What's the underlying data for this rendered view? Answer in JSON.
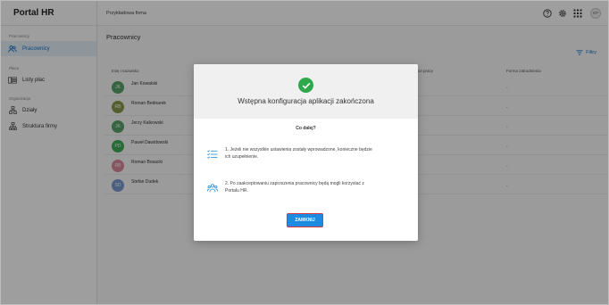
{
  "app": {
    "title": "Portal HR"
  },
  "sidebar": {
    "sections": [
      {
        "label": "Pracownicy",
        "items": [
          {
            "label": "Pracownicy",
            "icon": "people-icon",
            "active": true
          }
        ]
      },
      {
        "label": "Płace",
        "items": [
          {
            "label": "Listy płac",
            "icon": "payroll-icon",
            "active": false
          }
        ]
      },
      {
        "label": "Organizacja",
        "items": [
          {
            "label": "Działy",
            "icon": "departments-icon",
            "active": false
          },
          {
            "label": "Struktura firmy",
            "icon": "org-chart-icon",
            "active": false
          }
        ]
      }
    ]
  },
  "topbar": {
    "company": "Przykładowa firma",
    "user_initials": "KP",
    "icons": [
      "help-icon",
      "settings-icon",
      "apps-grid-icon"
    ]
  },
  "main": {
    "title": "Pracownicy",
    "filters_label": "Filtry",
    "columns": [
      "Imię i nazwisko",
      "…ace pracy",
      "Forma zatrudnienia"
    ],
    "employees": [
      {
        "initials": "JK",
        "name": "Jan Kowalski",
        "form": "-",
        "color": "#5aa36a"
      },
      {
        "initials": "RB",
        "name": "Roman Bednarek",
        "form": "-",
        "color": "#8a9a4a"
      },
      {
        "initials": "JK",
        "name": "Jerzy Kalkowski",
        "form": "-",
        "color": "#5aa36a"
      },
      {
        "initials": "PD",
        "name": "Paweł Dawidowski",
        "form": "-",
        "color": "#3fae5a"
      },
      {
        "initials": "RB",
        "name": "Roman Bosacki",
        "form": "-",
        "color": "#d98a9a"
      },
      {
        "initials": "SD",
        "name": "Stefan Dudek",
        "form": "-",
        "color": "#7a9bd0"
      }
    ]
  },
  "modal": {
    "title": "Wstępna konfiguracja aplikacji zakończona",
    "subtitle": "Co dalej?",
    "step1_line1": "1. Jeżeli nie wszystkie ustawienia zostały wprowadzone, konieczne będzie",
    "step1_line2": "ich uzupełnienie.",
    "step2_line1": "2. Po zaakceptowaniu zaproszenia pracownicy będą mogli korzystać z",
    "step2_line2": "Portalu HR.",
    "close_label": "ZAMKNIJ"
  },
  "colors": {
    "accent": "#1e8be0",
    "success": "#2ea84b",
    "highlight_border": "#d9363e"
  }
}
